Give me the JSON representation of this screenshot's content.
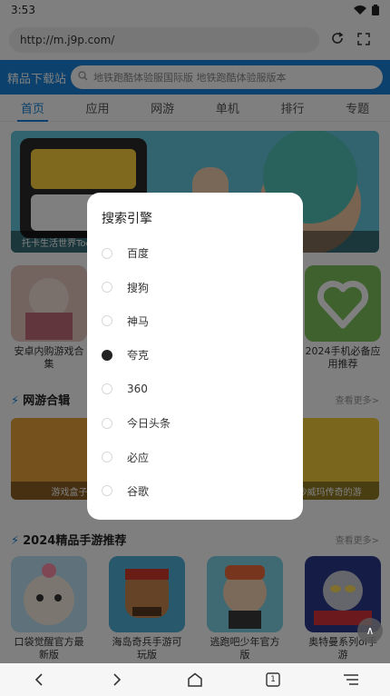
{
  "status": {
    "time": "3:53"
  },
  "urlbar": {
    "url": "http://m.j9p.com/"
  },
  "site": {
    "title": "精品下载站",
    "search_placeholder": "地铁跑酷体验服国际版 地铁跑酷体验服版本",
    "nav": [
      "首页",
      "应用",
      "网游",
      "单机",
      "排行",
      "专题"
    ],
    "banner_caption": "托卡生活世界Toca",
    "apps_top": [
      {
        "name": "安卓内购游戏合集"
      },
      {
        "name": ""
      },
      {
        "name": ""
      },
      {
        "name": "2024手机必备应用推荐"
      }
    ],
    "section1": {
      "title": "网游合辑",
      "more": "查看更多>"
    },
    "games": [
      {
        "caption": "游戏盒子"
      },
      {
        "caption": "类似沙威玛传奇的游"
      }
    ],
    "section2": {
      "title": "2024精品手游推荐",
      "more": "查看更多>"
    },
    "apps_bottom": [
      {
        "name": "口袋觉醒官方最新版"
      },
      {
        "name": "海岛奇兵手游可玩版"
      },
      {
        "name": "逃跑吧少年官方版"
      },
      {
        "name": "奥特曼系列ol手游"
      }
    ]
  },
  "dialog": {
    "title": "搜索引擎",
    "options": [
      "百度",
      "搜狗",
      "神马",
      "夸克",
      "360",
      "今日头条",
      "必应",
      "谷歌"
    ],
    "selected": "夸克"
  },
  "bottombar": {
    "tabs_count": "1"
  },
  "colors": {
    "accent": "#1683d8"
  }
}
